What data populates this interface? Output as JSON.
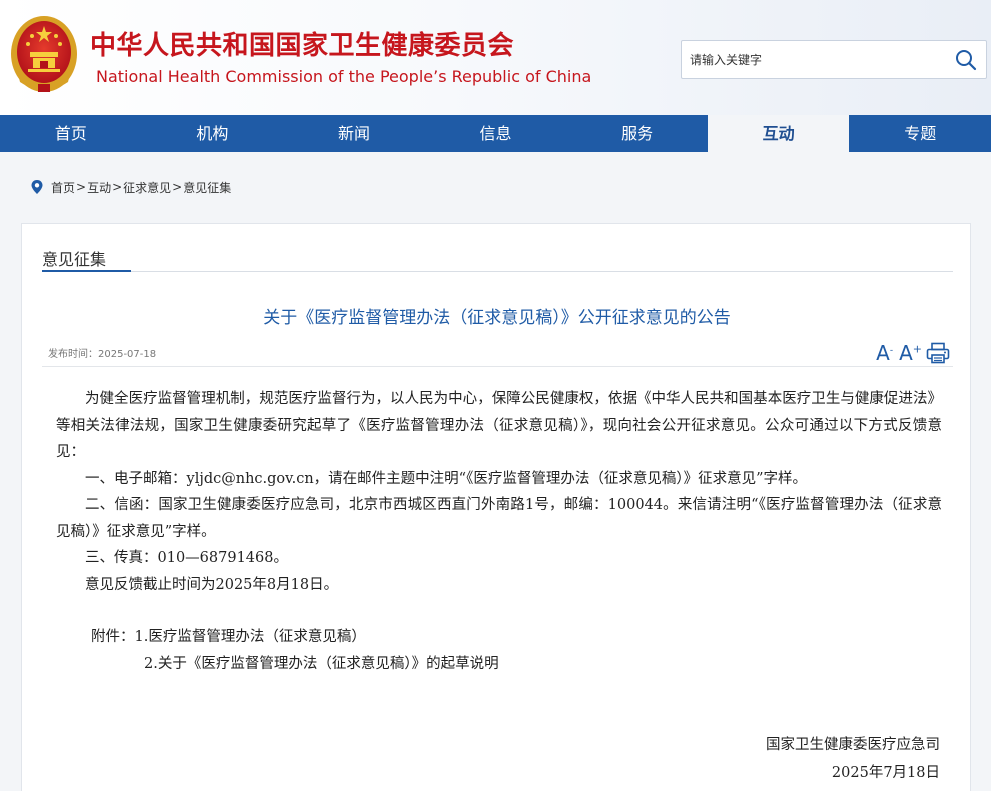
{
  "header": {
    "title_cn": "中华人民共和国国家卫生健康委员会",
    "title_en": "National Health Commission of the People’s  Republic of China",
    "search_placeholder": "请输入关键字",
    "emblem_icon": "national-emblem-icon",
    "search_icon": "search-icon"
  },
  "nav": {
    "items": [
      "首页",
      "机构",
      "新闻",
      "信息",
      "服务",
      "互动",
      "专题"
    ],
    "active": "互动"
  },
  "breadcrumb": {
    "icon": "location-pin-icon",
    "items": [
      "首页",
      "互动",
      "征求意见",
      "意见征集"
    ],
    "separator": ">"
  },
  "section": {
    "title": "意见征集"
  },
  "article": {
    "title": "关于《医疗监督管理办法（征求意见稿）》公开征求意见的公告",
    "date_label": "发布时间：",
    "date": "2025-07-18",
    "tools": {
      "font_decrease": "A",
      "font_increase": "A",
      "print_icon": "printer-icon"
    },
    "paragraphs": [
      "为健全医疗监督管理机制，规范医疗监督行为，以人民为中心，保障公民健康权，依据《中华人民共和国基本医疗卫生与健康促进法》等相关法律法规，国家卫生健康委研究起草了《医疗监督管理办法（征求意见稿）》，现向社会公开征求意见。公众可通过以下方式反馈意见：",
      "一、电子邮箱：yljdc@nhc.gov.cn，请在邮件主题中注明“《医疗监督管理办法（征求意见稿）》征求意见”字样。",
      "二、信函：国家卫生健康委医疗应急司，北京市西城区西直门外南路1号，邮编：100044。来信请注明“《医疗监督管理办法（征求意见稿）》征求意见”字样。",
      "三、传真：010—68791468。",
      "意见反馈截止时间为2025年8月18日。"
    ],
    "attachments_label": "附件：",
    "attachments": [
      "1.医疗监督管理办法（征求意见稿）",
      "2.关于《医疗监督管理办法（征求意见稿）》的起草说明"
    ],
    "signature": {
      "org": "国家卫生健康委医疗应急司",
      "date": "2025年7月18日"
    }
  },
  "colors": {
    "brand_red": "#c6161d",
    "nav_blue": "#1f5ba6",
    "link_blue": "#1f5ba6"
  }
}
